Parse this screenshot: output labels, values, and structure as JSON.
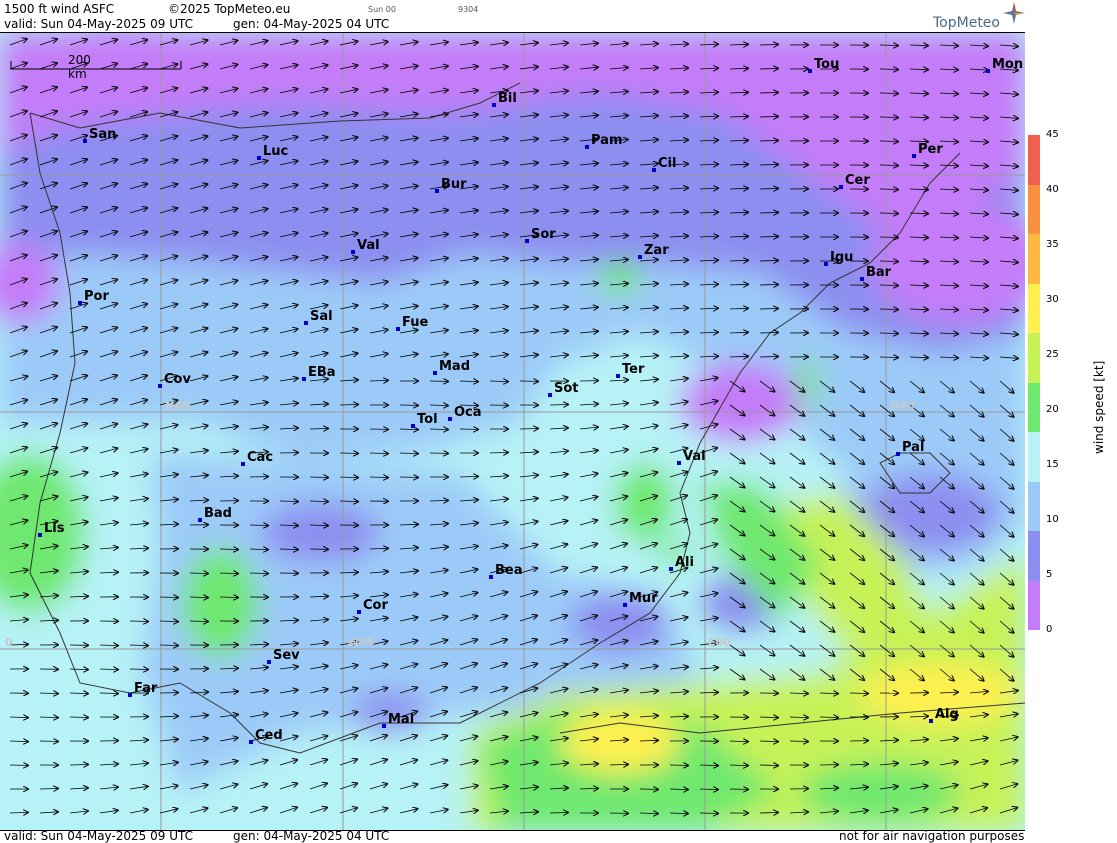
{
  "header": {
    "product": "1500 ft wind ASFC",
    "copyright": "©2025 TopMeteo.eu",
    "day_code": "Sun 00",
    "code": "9304",
    "valid_line": "valid:  Sun  04-May-2025  09 UTC",
    "gen_line": "gen: 04-May-2025 04 UTC",
    "logo": "TopMeteo"
  },
  "footer": {
    "valid_line": "valid:  Sun  04-May-2025  09 UTC",
    "gen_line": "gen: 04-May-2025 04 UTC",
    "disclaimer": "not for air navigation purposes"
  },
  "scale": {
    "label": "200 km"
  },
  "grid_labels": [
    {
      "id": "n40-left",
      "text": "N40"
    },
    {
      "id": "n40-right",
      "text": "N40"
    },
    {
      "id": "w05",
      "text": "W05"
    },
    {
      "id": "e00",
      "text": "E00"
    },
    {
      "id": "w10",
      "text": "0"
    }
  ],
  "cities": [
    "San",
    "Luc",
    "Bil",
    "Pam",
    "Cil",
    "Tou",
    "Mon",
    "Per",
    "Cer",
    "Bur",
    "Val",
    "Sor",
    "Zar",
    "Igu",
    "Bar",
    "Por",
    "Sal",
    "Fue",
    "Mad",
    "EBa",
    "Cov",
    "Sot",
    "Ter",
    "Tol",
    "Oca",
    "Cac",
    "Val",
    "Pal",
    "Bad",
    "Lis",
    "Bea",
    "Ali",
    "Mur",
    "Cor",
    "Sev",
    "Far",
    "Mal",
    "Ced",
    "Alg"
  ],
  "legend": {
    "title": "wind speed [kt]",
    "ticks": [
      "45",
      "40",
      "35",
      "30",
      "25",
      "20",
      "15",
      "10",
      "5",
      "0"
    ],
    "colors": [
      "#f06050",
      "#f89040",
      "#fcb840",
      "#fff050",
      "#c6f258",
      "#6ee86e",
      "#b6f2f6",
      "#9ccaf8",
      "#8c8ef0",
      "#c47cf8"
    ]
  },
  "wind_field": {
    "unit": "kt",
    "prevailing_direction": "west to east (southwest over land, northwest over the Mediterranean)"
  }
}
